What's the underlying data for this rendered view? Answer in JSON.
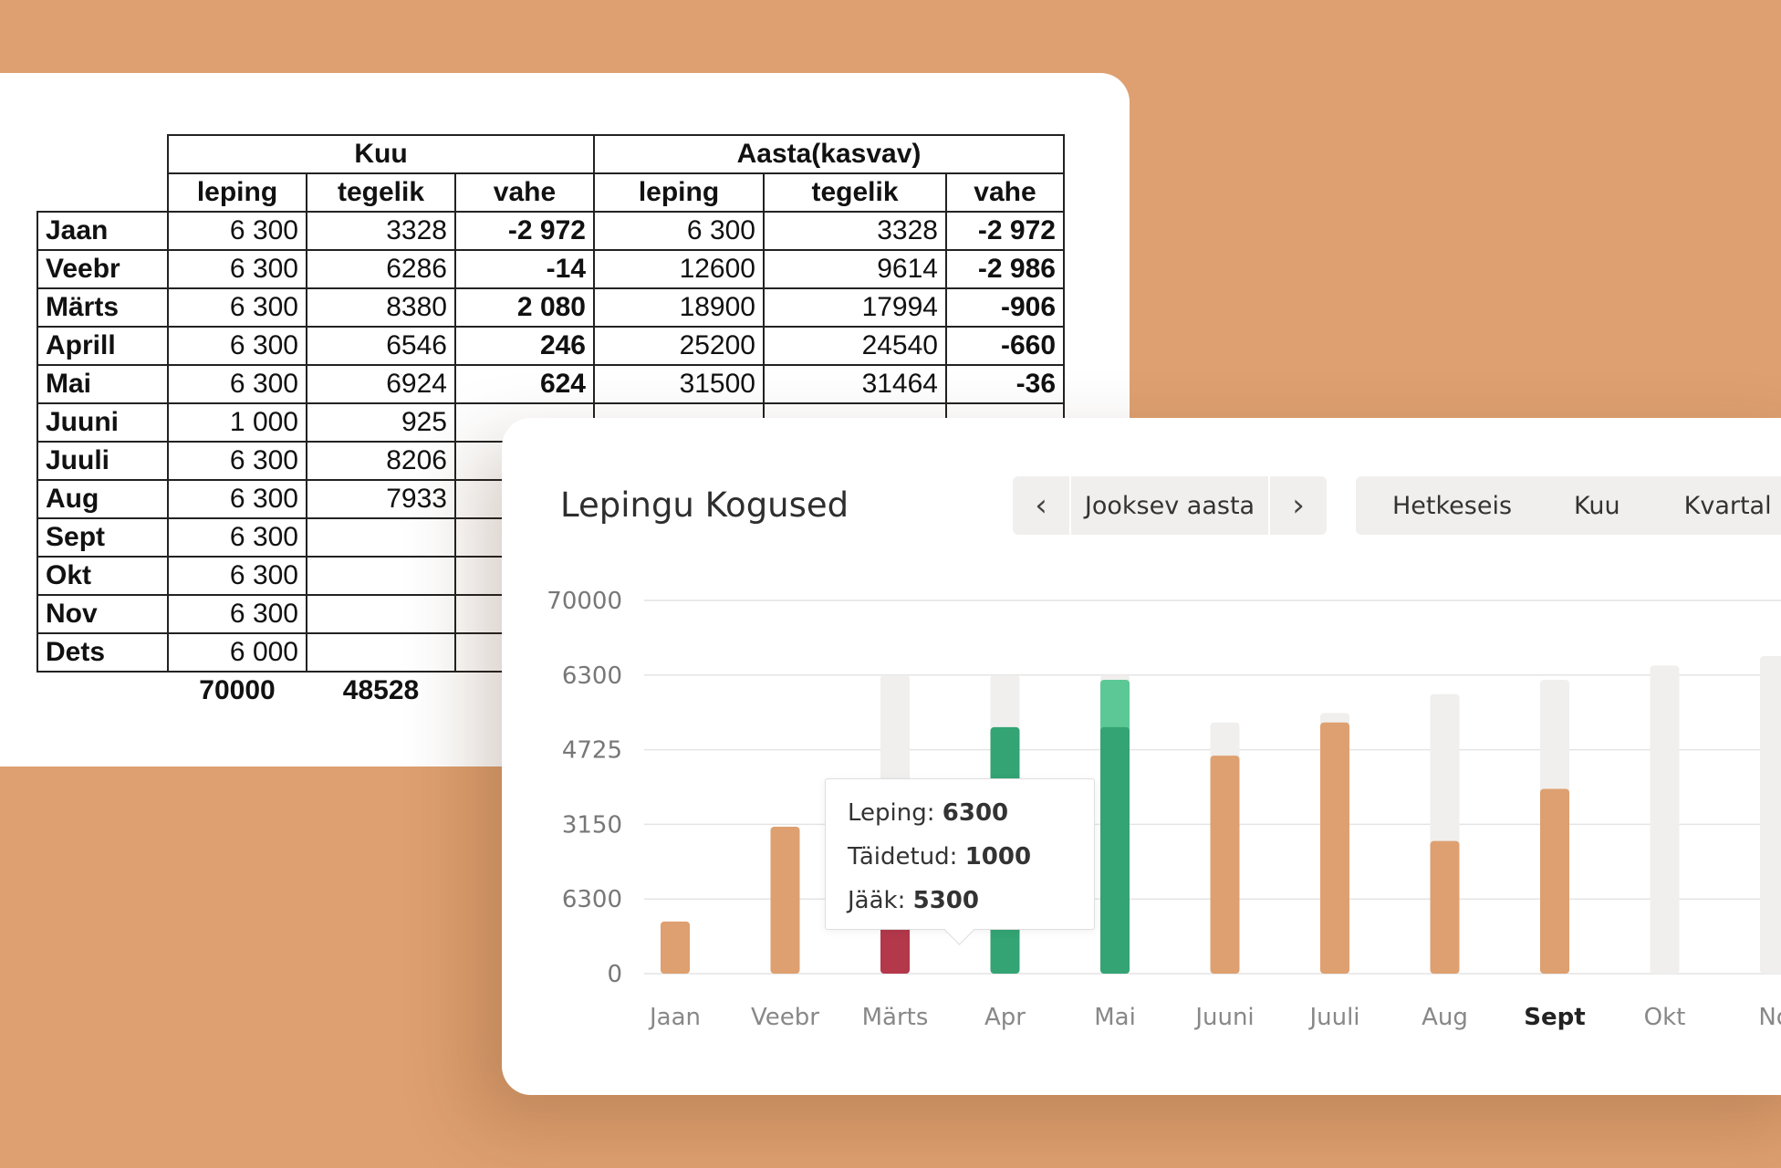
{
  "sheet": {
    "group_headers": [
      "Kuu",
      "Aasta(kasvav)"
    ],
    "col_headers": [
      "leping",
      "tegelik",
      "vahe",
      "leping",
      "tegelik",
      "vahe"
    ],
    "rows": [
      {
        "month": "Jaan",
        "leping": "6 300",
        "tegelik": "3328",
        "vahe": "-2 972",
        "a_leping": "6 300",
        "a_tegelik": "3328",
        "a_vahe": "-2 972"
      },
      {
        "month": "Veebr",
        "leping": "6 300",
        "tegelik": "6286",
        "vahe": "-14",
        "a_leping": "12600",
        "a_tegelik": "9614",
        "a_vahe": "-2 986"
      },
      {
        "month": "Märts",
        "leping": "6 300",
        "tegelik": "8380",
        "vahe": "2 080",
        "a_leping": "18900",
        "a_tegelik": "17994",
        "a_vahe": "-906"
      },
      {
        "month": "Aprill",
        "leping": "6 300",
        "tegelik": "6546",
        "vahe": "246",
        "a_leping": "25200",
        "a_tegelik": "24540",
        "a_vahe": "-660"
      },
      {
        "month": "Mai",
        "leping": "6 300",
        "tegelik": "6924",
        "vahe": "624",
        "a_leping": "31500",
        "a_tegelik": "31464",
        "a_vahe": "-36"
      },
      {
        "month": "Juuni",
        "leping": "1 000",
        "tegelik": "925",
        "vahe": "",
        "a_leping": "",
        "a_tegelik": "",
        "a_vahe": ""
      },
      {
        "month": "Juuli",
        "leping": "6 300",
        "tegelik": "8206",
        "vahe": "",
        "a_leping": "",
        "a_tegelik": "",
        "a_vahe": ""
      },
      {
        "month": "Aug",
        "leping": "6 300",
        "tegelik": "7933",
        "vahe": "",
        "a_leping": "",
        "a_tegelik": "",
        "a_vahe": ""
      },
      {
        "month": "Sept",
        "leping": "6 300",
        "tegelik": "",
        "vahe": "",
        "a_leping": "",
        "a_tegelik": "",
        "a_vahe": ""
      },
      {
        "month": "Okt",
        "leping": "6 300",
        "tegelik": "",
        "vahe": "",
        "a_leping": "",
        "a_tegelik": "",
        "a_vahe": ""
      },
      {
        "month": "Nov",
        "leping": "6 300",
        "tegelik": "",
        "vahe": "",
        "a_leping": "",
        "a_tegelik": "",
        "a_vahe": ""
      },
      {
        "month": "Dets",
        "leping": "6 000",
        "tegelik": "",
        "vahe": "",
        "a_leping": "",
        "a_tegelik": "",
        "a_vahe": ""
      }
    ],
    "totals": {
      "leping": "70000",
      "tegelik": "48528"
    }
  },
  "widget": {
    "title": "Lepingu Kogused",
    "period_label": "Jooksev aasta",
    "tabs": [
      "Hetkeseis",
      "Kuu",
      "Kvartal"
    ]
  },
  "tooltip": {
    "leping_label": "Leping:",
    "leping_value": "6300",
    "taidetud_label": "Täidetud:",
    "taidetud_value": "1000",
    "jaak_label": "Jääk:",
    "jaak_value": "5300"
  },
  "colors": {
    "page_bg": "#dea070",
    "bar_orange": "#dea070",
    "bar_green": "#34a474",
    "bar_green_light": "#5cc895",
    "bar_red": "#b3384a",
    "bar_track": "#f0efed"
  },
  "icons": {
    "prev": "chevron-left-icon",
    "next": "chevron-right-icon"
  },
  "chart_data": {
    "type": "bar",
    "categories": [
      "Jaan",
      "Veebr",
      "Märts",
      "Apr",
      "Mai",
      "Juuni",
      "Juuli",
      "Aug",
      "Sept",
      "Okt",
      "No"
    ],
    "highlighted_category": "Sept",
    "y_tick_labels": [
      "0",
      "6300",
      "3150",
      "4725",
      "6300",
      "70000"
    ],
    "ylim": [
      0,
      7875
    ],
    "grid": true,
    "series": [
      {
        "name": "Leping",
        "values": [
          900,
          2000,
          6300,
          6300,
          6300,
          5300,
          5500,
          5900,
          6200,
          6500,
          6700
        ]
      },
      {
        "name": "Täidetud",
        "values": [
          1100,
          3100,
          1000,
          5200,
          5200,
          4600,
          5300,
          2800,
          3900,
          0,
          0
        ]
      },
      {
        "name": "Jääk",
        "values": [
          0,
          0,
          5300,
          0,
          0,
          0,
          0,
          0,
          0,
          0,
          0
        ]
      }
    ],
    "bar_styles": [
      "orange",
      "orange",
      "red",
      "green",
      "green",
      "orange",
      "orange",
      "orange",
      "orange",
      "none",
      "none"
    ],
    "mai_bar_light_value": 6200
  }
}
